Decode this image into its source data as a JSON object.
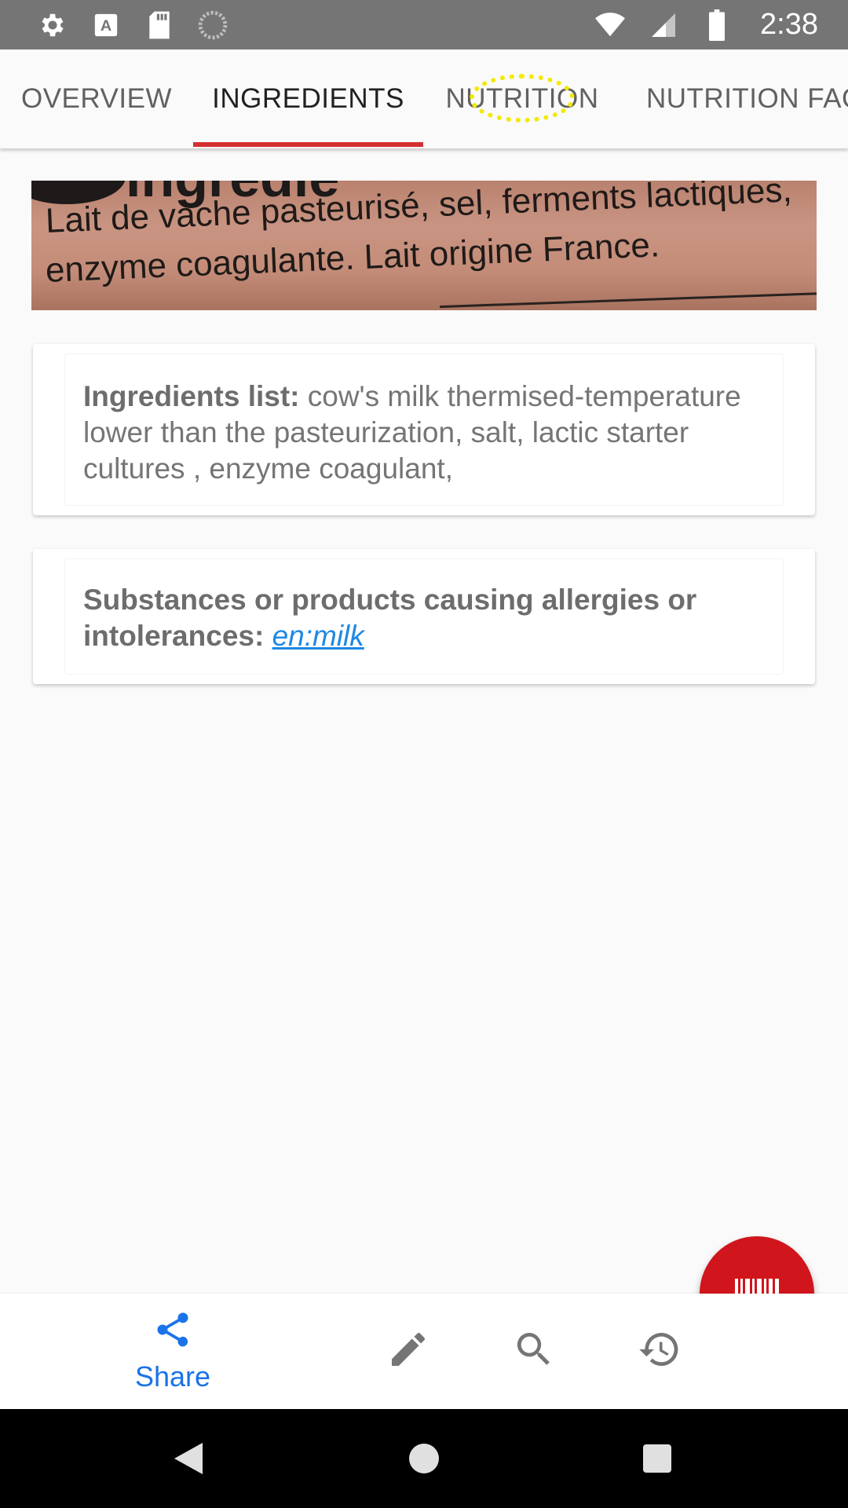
{
  "status_bar": {
    "time": "2:38",
    "left_icons": [
      "settings-icon",
      "a-box-icon",
      "sd-card-icon",
      "sync-icon"
    ],
    "right_icons": [
      "wifi-icon",
      "signal-icon",
      "battery-icon"
    ]
  },
  "tabs": [
    {
      "label": "OVERVIEW",
      "active": false
    },
    {
      "label": "INGREDIENTS",
      "active": true
    },
    {
      "label": "NUTRITION",
      "active": false
    },
    {
      "label": "NUTRITION FACTS",
      "active": false
    }
  ],
  "photo": {
    "heading_fragment": "ingredie",
    "line1": "Lait de vache pasteurisé, sel, ferments lactiques,",
    "line2": "enzyme coagulante. Lait origine France."
  },
  "ingredients_card": {
    "label": "Ingredients list:",
    "text": " cow's milk thermised-temperature lower than the pasteurization, salt, lactic starter cultures , enzyme coagulant,"
  },
  "allergens_card": {
    "label": "Substances or products causing allergies or intolerances:",
    "link": "en:milk"
  },
  "bottom_nav": {
    "share_label": "Share",
    "items": [
      "share-icon",
      "edit-icon",
      "search-icon",
      "history-icon"
    ]
  },
  "fab": {
    "icon": "barcode-icon"
  },
  "colors": {
    "accent": "#d32f2f",
    "fab": "#d0161c",
    "link": "#1e88e5",
    "share": "#1a73e8",
    "status_bar": "#757575"
  }
}
